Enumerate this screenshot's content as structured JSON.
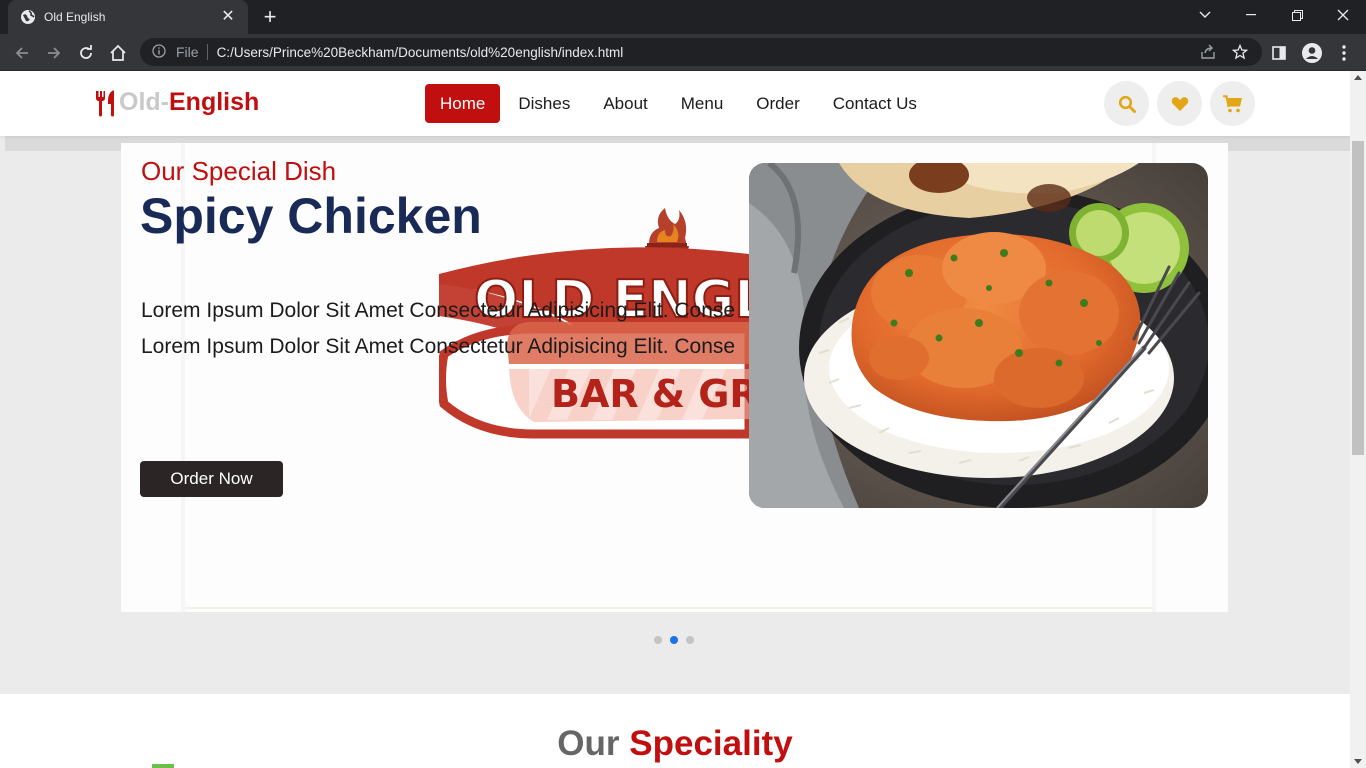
{
  "browser": {
    "tab_title": "Old English",
    "omnibox_file": "File",
    "url": "C:/Users/Prince%20Beckham/Documents/old%20english/index.html"
  },
  "site": {
    "logo_part1": "Old-",
    "logo_part2": "English",
    "nav": [
      "Home",
      "Dishes",
      "About",
      "Menu",
      "Order",
      "Contact Us"
    ],
    "active_nav": "Home"
  },
  "hero": {
    "subtitle": "Our Special Dish",
    "title": "Spicy Chicken",
    "description": "Lorem Ipsum Dolor Sit Amet Consectetur Adipisicing Elit. Conse Lorem Ipsum Dolor Sit Amet Consectetur Adipisicing Elit. Conse",
    "button": "Order Now",
    "watermark_text_1": "OLD ENGL",
    "watermark_text_2": "BAR & GRILL",
    "slides_count": 3,
    "active_slide": 2
  },
  "speciality": {
    "part1": "Our",
    "part2": "Speciality"
  },
  "colors": {
    "brand_red": "#c10e0e",
    "navy": "#192a56",
    "gold": "#e2a617"
  }
}
